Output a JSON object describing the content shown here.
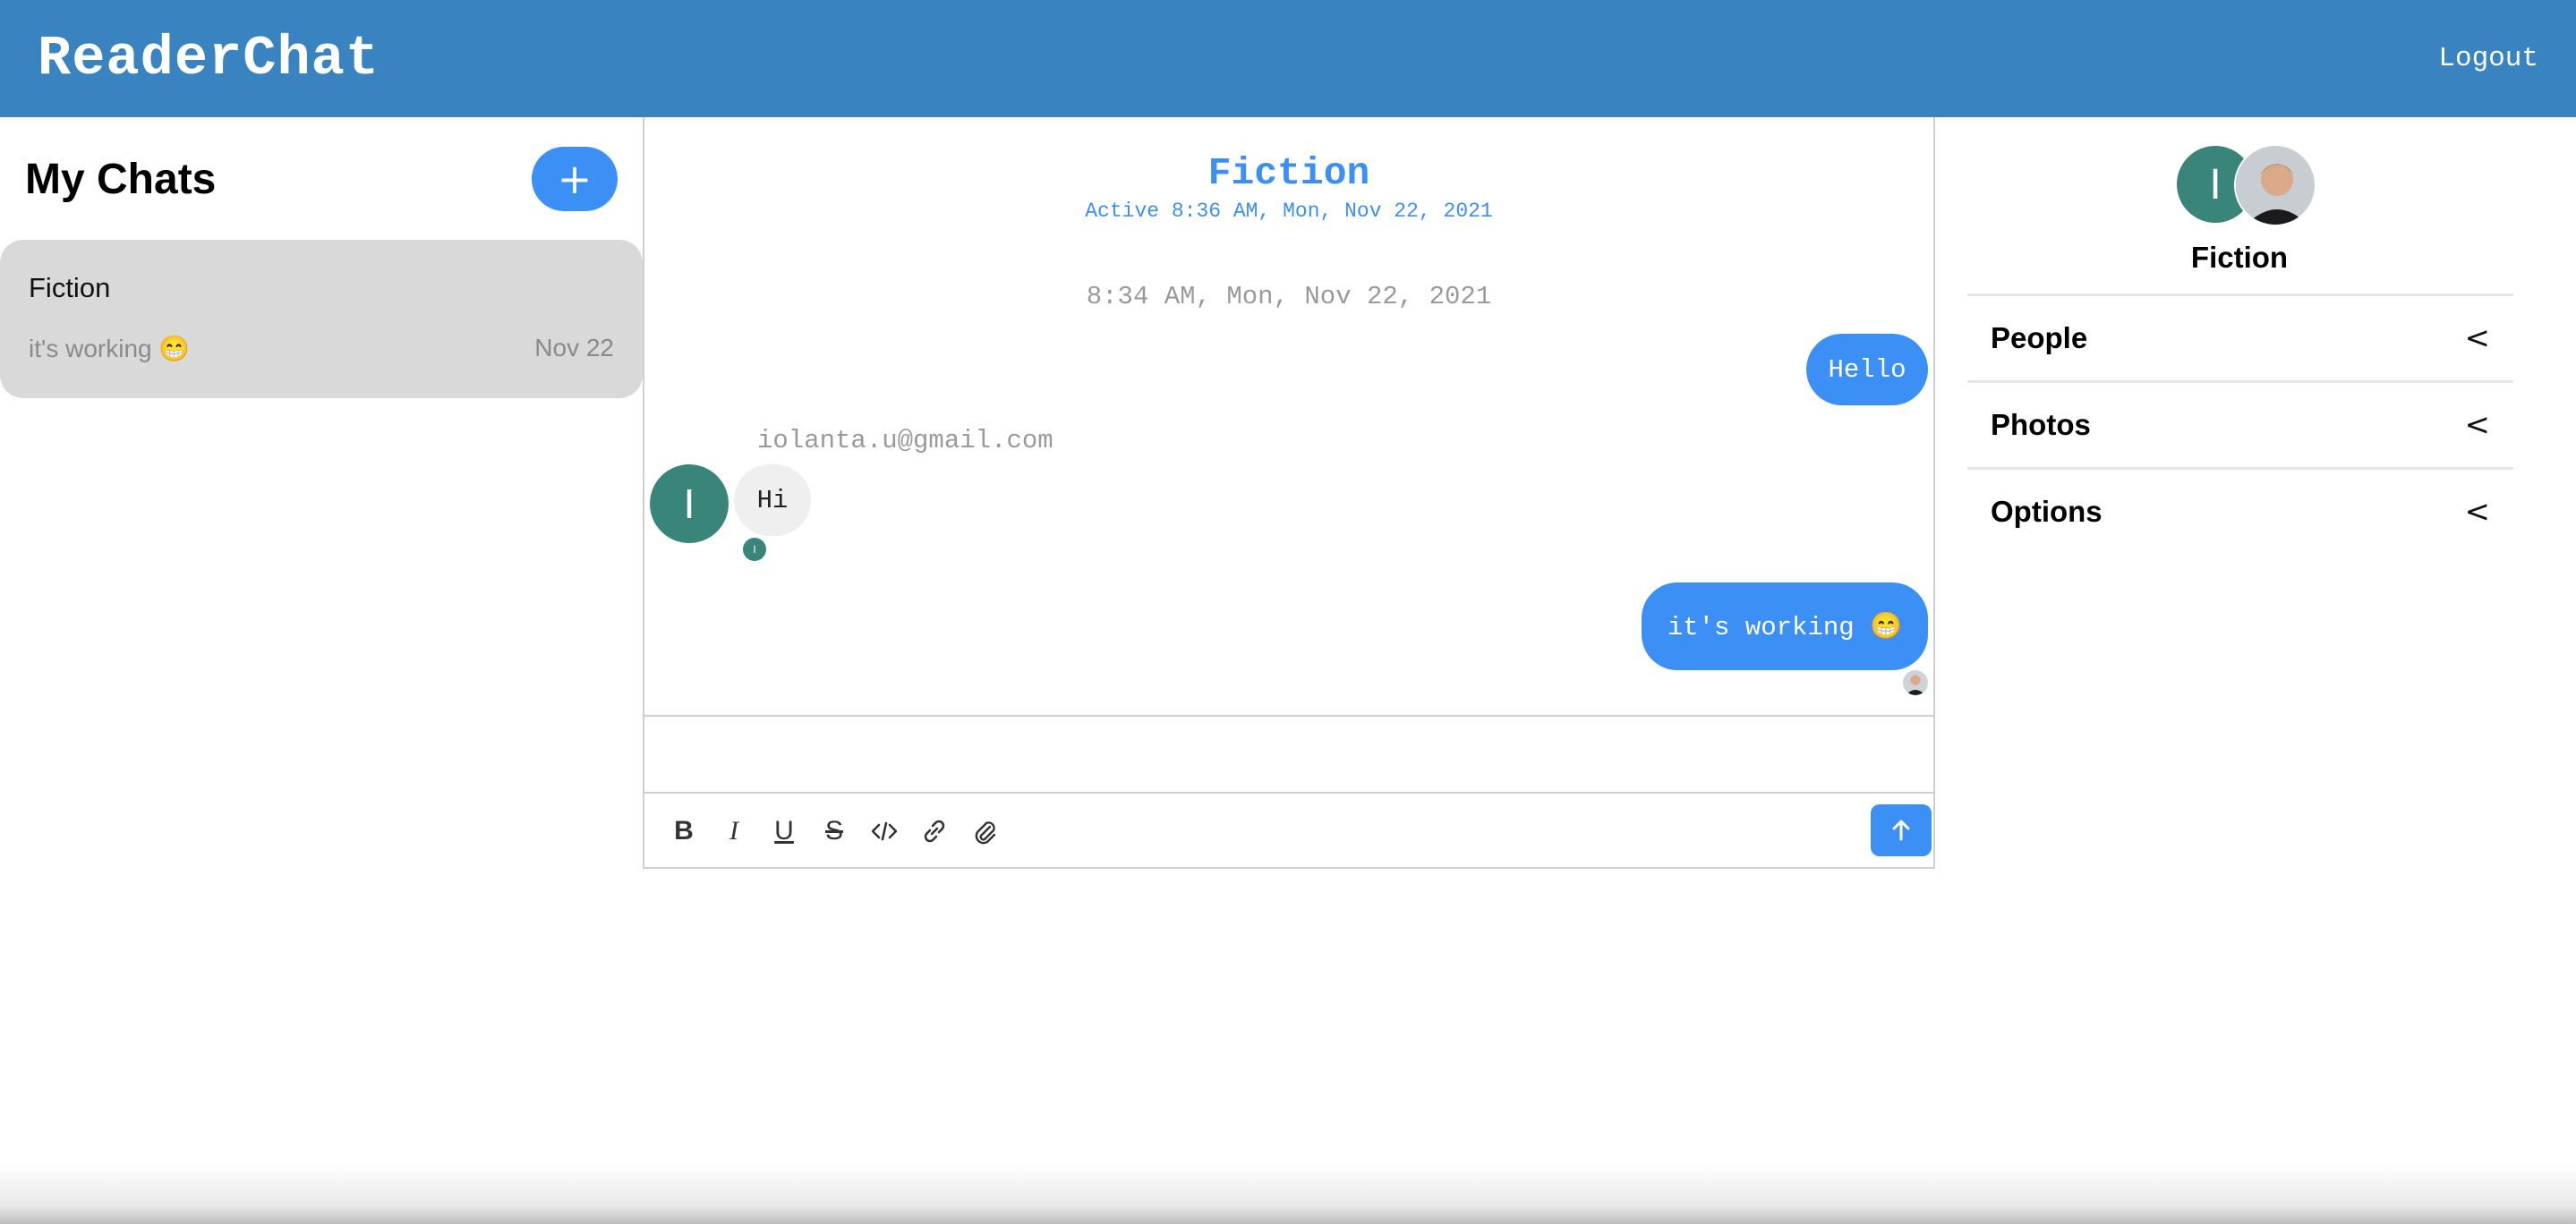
{
  "header": {
    "brand": "ReaderChat",
    "logout_label": "Logout",
    "color": "#3883c0"
  },
  "sidebar": {
    "title": "My Chats",
    "new_chat_label": "+",
    "chats": [
      {
        "name": "Fiction",
        "preview": "it's working 😁",
        "date": "Nov 22"
      }
    ]
  },
  "chat": {
    "title": "Fiction",
    "active": "Active 8:36 AM, Mon, Nov 22, 2021",
    "date_separator": "8:34 AM, Mon, Nov 22, 2021",
    "messages": [
      {
        "direction": "out",
        "text": "Hello"
      },
      {
        "direction": "in",
        "sender": "iolanta.u@gmail.com",
        "avatar_initial": "I",
        "text": "Hi",
        "read_initial": "I"
      },
      {
        "direction": "out",
        "text": "it's working 😁"
      }
    ],
    "composer": {
      "placeholder": "",
      "tools": [
        "bold-icon",
        "italic-icon",
        "underline-icon",
        "strikethrough-icon",
        "code-icon",
        "link-icon",
        "attach-icon"
      ],
      "send_icon": "arrow-up-icon"
    },
    "accent": "#3b8ff5"
  },
  "details": {
    "avatar_initial": "I",
    "title": "Fiction",
    "sections": [
      {
        "label": "People",
        "icon": "chevron-left-icon"
      },
      {
        "label": "Photos",
        "icon": "chevron-left-icon"
      },
      {
        "label": "Options",
        "icon": "chevron-left-icon"
      }
    ]
  }
}
